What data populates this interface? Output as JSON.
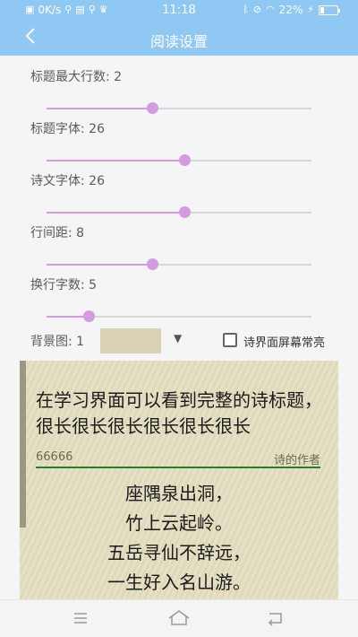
{
  "status_bar": {
    "network": "0K/s",
    "time": "11:18",
    "battery": "22%",
    "battery_level": 0.22
  },
  "header": {
    "title": "阅读设置",
    "back_icon": "chevron-left-icon"
  },
  "settings": [
    {
      "label": "标题最大行数: 2",
      "fraction": 0.4
    },
    {
      "label": "标题字体: 26",
      "fraction": 0.52
    },
    {
      "label": "诗文字体: 26",
      "fraction": 0.52
    },
    {
      "label": "行间距: 8",
      "fraction": 0.4
    },
    {
      "label": "换行字数: 5",
      "fraction": 0.16
    }
  ],
  "background": {
    "label": "背景图: 1",
    "swatch_color": "#d9d2b5",
    "dropdown_icon": "caret-down-icon"
  },
  "keep_screen_on": {
    "label": "诗界面屏幕常亮",
    "checked": false
  },
  "preview": {
    "title": "在学习界面可以看到完整的诗标题，很长很长很长很长很长很长",
    "left_meta": "66666",
    "right_meta": "诗的作者",
    "lines": [
      "座隅泉出洞，",
      "竹上云起岭。",
      "五岳寻仙不辞远，",
      "一生好入名山游。"
    ]
  },
  "colors": {
    "accent": "#8fc8f2",
    "slider": "#d49be0",
    "preview_bg": "#e4dec0",
    "underline": "#2f7a2a"
  }
}
